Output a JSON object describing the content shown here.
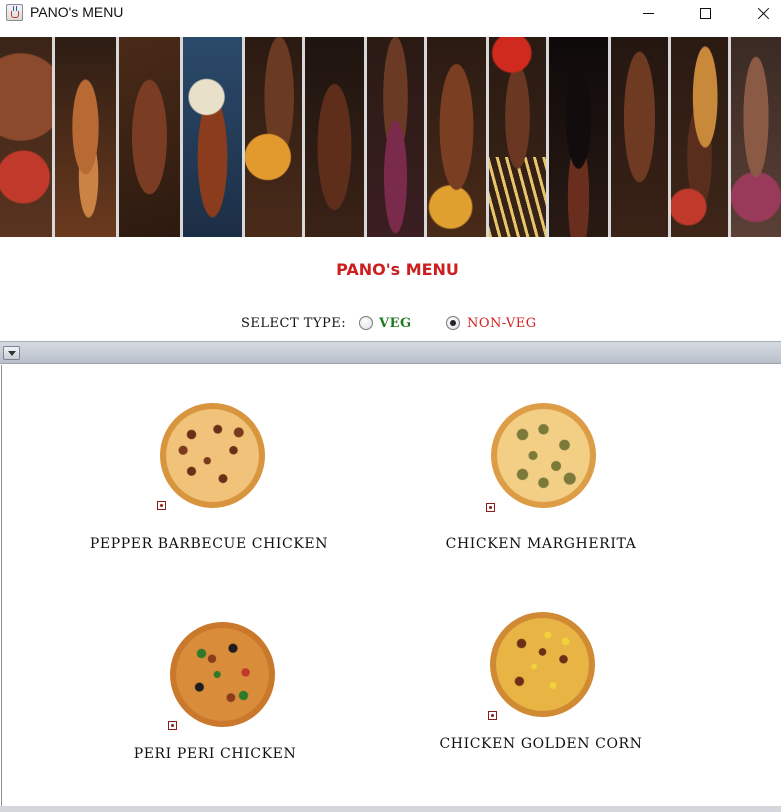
{
  "window": {
    "title": "PANO's MENU",
    "app_icon": "java-cup-icon",
    "controls": [
      "minimize-icon",
      "maximize-icon",
      "close-icon"
    ]
  },
  "banner": {
    "strips": 13
  },
  "heading": "PANO's MENU",
  "filter": {
    "label": "SELECT TYPE:",
    "options": [
      {
        "label": "VEG",
        "selected": false,
        "color": "#1e7a1e"
      },
      {
        "label": "NON-VEG",
        "selected": true,
        "color": "#d42020"
      }
    ]
  },
  "items": [
    {
      "name": "PEPPER BARBECUE CHICKEN",
      "type": "non-veg"
    },
    {
      "name": "CHICKEN MARGHERITA",
      "type": "non-veg"
    },
    {
      "name": "PERI PERI CHICKEN",
      "type": "non-veg"
    },
    {
      "name": "CHICKEN GOLDEN CORN",
      "type": "non-veg"
    }
  ],
  "colors": {
    "heading": "#cc1f1f",
    "non_veg_mark": "#8a1c1c"
  }
}
